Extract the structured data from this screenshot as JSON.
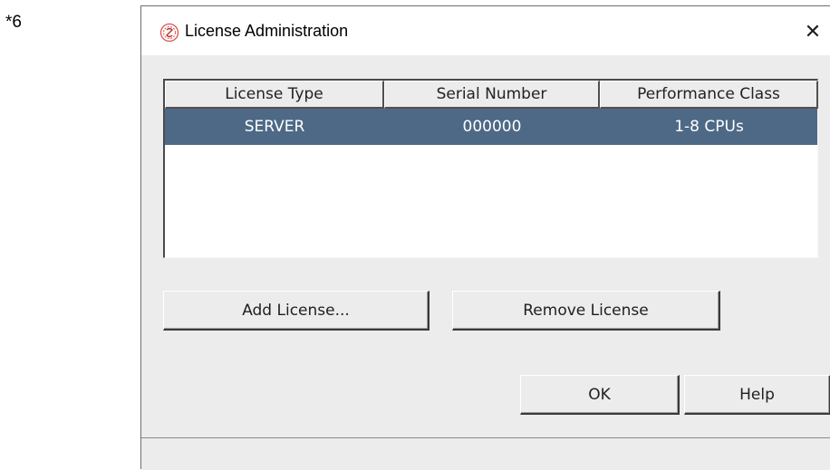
{
  "footnote": "*6",
  "window": {
    "title": "License Administration",
    "close_glyph": "✕"
  },
  "table": {
    "headers": [
      "License Type",
      "Serial Number",
      "Performance Class"
    ],
    "rows": [
      {
        "license_type": "SERVER",
        "serial_number": "000000",
        "performance_class": "1-8 CPUs",
        "selected": true
      }
    ]
  },
  "buttons": {
    "add_license": "Add License...",
    "remove_license": "Remove License",
    "ok": "OK",
    "help": "Help"
  },
  "colors": {
    "selection": "#4d6986",
    "window_bg": "#ececec",
    "icon_accent": "#d9534f"
  },
  "icons": {
    "app": "license-app-icon",
    "close": "close-icon"
  }
}
